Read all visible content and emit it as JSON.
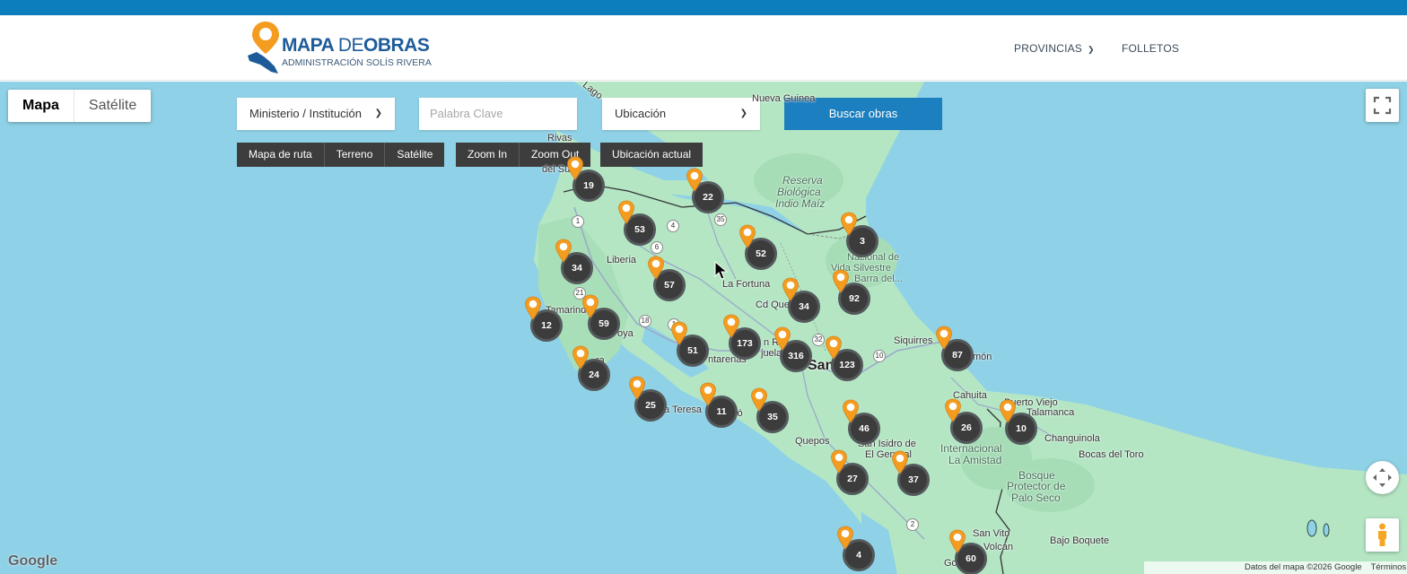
{
  "header": {
    "logo": {
      "main_bold1": "MAPA ",
      "main_light": "DE",
      "main_bold2": "OBRAS",
      "subtitle": "ADMINISTRACIÓN SOLÍS RIVERA"
    },
    "nav": [
      {
        "label": "PROVINCIAS",
        "has_dropdown": true
      },
      {
        "label": "FOLLETOS",
        "has_dropdown": false
      }
    ]
  },
  "map": {
    "type_control": {
      "map": "Mapa",
      "satellite": "Satélite",
      "active": "Mapa"
    },
    "filters": {
      "ministry": "Ministerio / Institución",
      "keyword_placeholder": "Palabra Clave",
      "location": "Ubicación",
      "search_button": "Buscar obras"
    },
    "tools": {
      "road_map": "Mapa de ruta",
      "terrain": "Terreno",
      "satellite": "Satélite",
      "zoom_in": "Zoom In",
      "zoom_out": "Zoom Out",
      "current_location": "Ubicación actual"
    },
    "clusters": [
      "19",
      "22",
      "53",
      "3",
      "52",
      "34",
      "57",
      "92",
      "34",
      "12",
      "59",
      "173",
      "51",
      "316",
      "123",
      "87",
      "24",
      "25",
      "11",
      "35",
      "46",
      "26",
      "10",
      "27",
      "37",
      "4",
      "60"
    ],
    "places": {
      "lago": "Lago",
      "nueva": "Nueva Guinea",
      "rivas": "Rivas",
      "delsur": "del Sur",
      "reserva": "Reserva",
      "biologica": "Biológica",
      "indiomaiz": "Indio Maíz",
      "liberia": "Liberia",
      "nacional": "Nacional de",
      "vidasilv": "Vida Silvestre",
      "barradel": "Barra del...",
      "fortuna": "La Fortuna",
      "cdques": "Cd Ques",
      "tamarind": "Tamarind",
      "oya": "oya",
      "sanra": "n Ra",
      "alajuela": "juela",
      "puntarenas": "ntarenas",
      "sanj": "San",
      "siquirres": "Siquirres",
      "limon": "món",
      "cahuita": "Cahuita",
      "pviejo": "Puerto Viejo",
      "talamanca": "Talamanca",
      "santateresa": "a Teresa",
      "co": "có",
      "quepos": "Quepos",
      "chang": "Changuinola",
      "internacional": "Internacional",
      "amistad": "La Amistad",
      "bocas": "Bocas del Toro",
      "sanisidro": "San Isidro de",
      "elgeneral": "El General",
      "bosque": "Bosque",
      "protector": "Protector de",
      "paloseco": "Palo Seco",
      "sanvito": "San Vito",
      "volcan": "Volcán",
      "bajo": "Bajo Boquete",
      "ra": "ra",
      "de": "de",
      "go": "Go"
    },
    "routes": [
      "1",
      "4",
      "35",
      "6",
      "21",
      "18",
      "1",
      "32",
      "10",
      "2"
    ],
    "google": "Google",
    "attribution": "Datos del mapa ©2026 Google",
    "terms": "Términos"
  },
  "colors": {
    "brand_blue": "#1c7fbf",
    "top_bar": "#0d7ebd",
    "pin_orange": "#f39c1f",
    "cluster": "#3c3c3c",
    "water": "#8fd1e6",
    "land": "#b4e6c4"
  }
}
